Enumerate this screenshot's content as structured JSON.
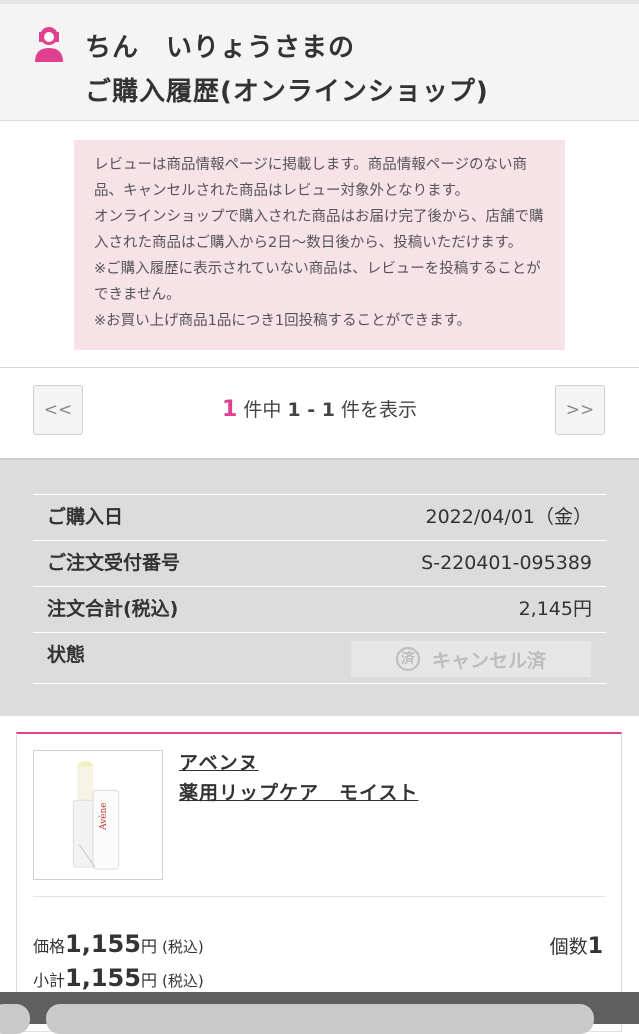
{
  "header": {
    "title_line1": "ちん　いりょうさまの",
    "title_line2": "ご購入履歴(オンラインショップ)",
    "icon": "user-icon",
    "accent": "#e0418f"
  },
  "notice": {
    "lines": [
      "レビューは商品情報ページに掲載します。商品情報ページのない商",
      "品、キャンセルされた商品はレビュー対象外となります。",
      "オンラインショップで購入された商品はお届け完了後から、店舗で購",
      "入された商品はご購入から2日〜数日後から、投稿いただけます。",
      "※ご購入履歴に表示されていない商品は、レビューを投稿することが",
      "できません。",
      "※お買い上げ商品1品につき1回投稿することができます。"
    ],
    "background": "#f7e2e8"
  },
  "pager": {
    "prev": "<<",
    "next": ">>",
    "total": "1",
    "text_middle": "件中",
    "range": "1 - 1",
    "text_end": "件を表示"
  },
  "order": {
    "rows": [
      {
        "label": "ご購入日",
        "value": "2022/04/01（金）"
      },
      {
        "label": "ご注文受付番号",
        "value": "S-220401-095389"
      },
      {
        "label": "注文合計(税込)",
        "value": "2,145円"
      }
    ],
    "status_label": "状態",
    "status_badge_char": "済",
    "status_text": "キャンセル済"
  },
  "product": {
    "brand": "アベンヌ",
    "name": "薬用リップケア　モイスト",
    "price_label": "価格",
    "price": "1,155",
    "price_unit": "円",
    "tax_note": "(税込)",
    "subtotal_label": "小計",
    "subtotal": "1,155",
    "subtotal_unit": "円",
    "subtotal_tax_note": "(税込)",
    "qty_label": "個数",
    "qty": "1"
  }
}
